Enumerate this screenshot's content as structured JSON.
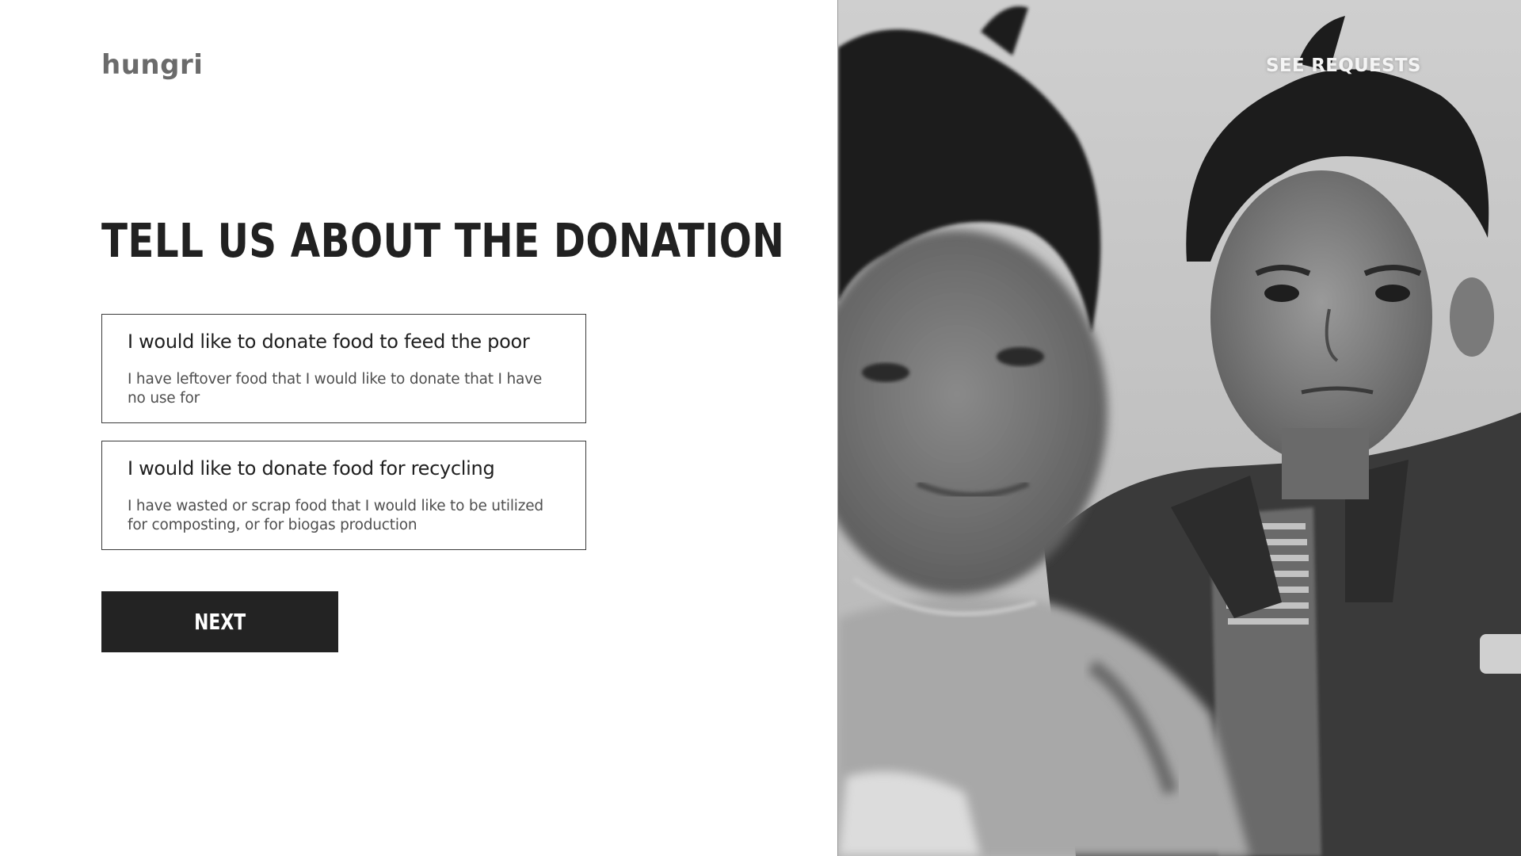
{
  "app": {
    "logo_text": "hungri"
  },
  "nav": {
    "see_requests_label": "SEE REQUESTS"
  },
  "form": {
    "title": "TELL US ABOUT THE DONATION",
    "options": [
      {
        "title": "I would like to donate food to feed the poor",
        "description": "I have leftover food that I would like to donate that I have no use for"
      },
      {
        "title": "I would like to donate food for recycling",
        "description": "I have wasted or scrap food that I would like to be utilized for composting, or for biogas production"
      }
    ],
    "next_label": "NEXT"
  },
  "hero_image": {
    "subject": "two children portrait",
    "style": "black-and-white"
  },
  "colors": {
    "primary_dark": "#232323",
    "logo_gray": "#6b6b6b",
    "border": "#3a3a3a",
    "background": "#ffffff"
  }
}
